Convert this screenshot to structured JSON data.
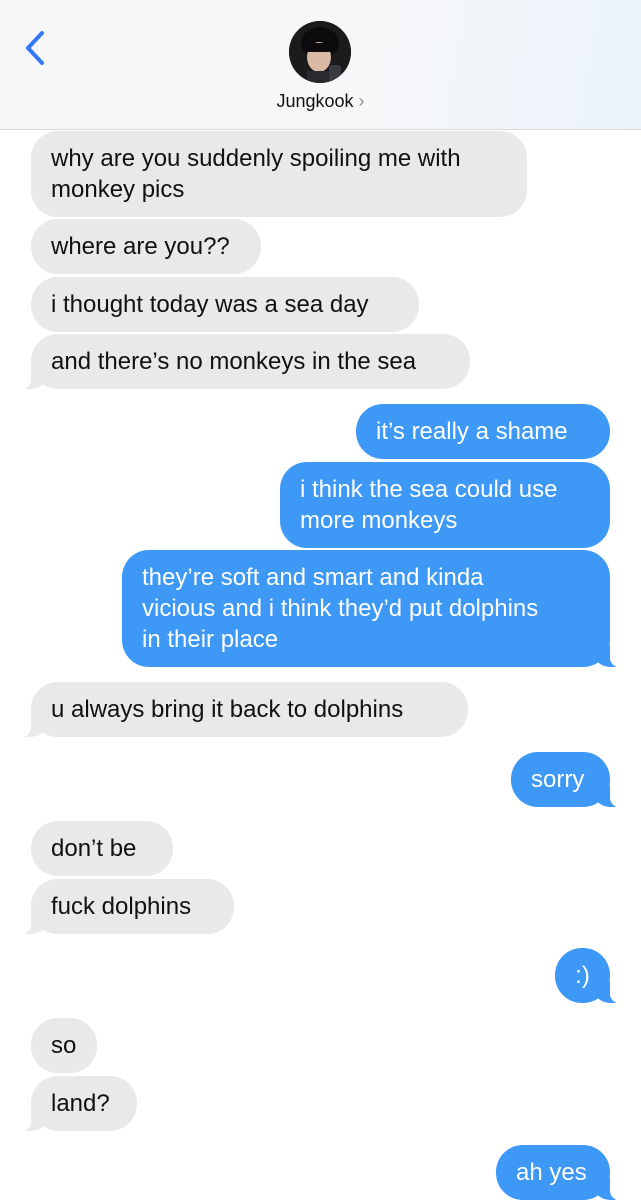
{
  "header": {
    "contact_name": "Jungkook",
    "chevron": "›",
    "back_icon": "chevron-left-icon",
    "accent_color": "#3478f6"
  },
  "colors": {
    "incoming_bubble": "#e9e9eb",
    "outgoing_bubble": "#3d98f6"
  },
  "messages": [
    {
      "from": "contact",
      "lines": [
        "why are you suddenly spoiling me with",
        "monkey pics"
      ]
    },
    {
      "from": "contact",
      "lines": [
        "where are you??"
      ]
    },
    {
      "from": "contact",
      "lines": [
        "i thought today was a sea day"
      ]
    },
    {
      "from": "contact",
      "lines": [
        "and there’s no monkeys in the sea"
      ]
    },
    {
      "from": "me",
      "lines": [
        "it’s really a shame"
      ]
    },
    {
      "from": "me",
      "lines": [
        "i think the sea could use",
        "more monkeys"
      ]
    },
    {
      "from": "me",
      "lines": [
        "they’re soft and smart and kinda",
        "vicious and i think they’d put dolphins",
        "in their place"
      ]
    },
    {
      "from": "contact",
      "lines": [
        "u always bring it back to dolphins"
      ]
    },
    {
      "from": "me",
      "lines": [
        "sorry"
      ]
    },
    {
      "from": "contact",
      "lines": [
        "don’t be"
      ]
    },
    {
      "from": "contact",
      "lines": [
        "fuck dolphins"
      ]
    },
    {
      "from": "me",
      "lines": [
        ":)"
      ]
    },
    {
      "from": "contact",
      "lines": [
        "so"
      ]
    },
    {
      "from": "contact",
      "lines": [
        "land?"
      ]
    },
    {
      "from": "me",
      "lines": [
        "ah yes"
      ]
    }
  ]
}
